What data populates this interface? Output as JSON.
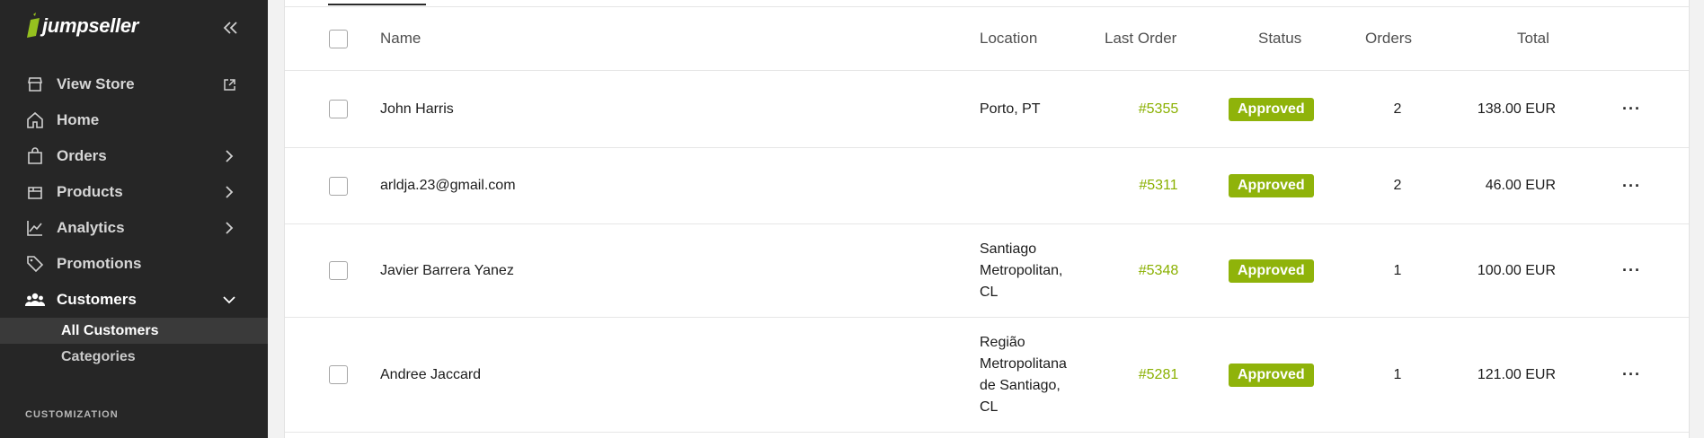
{
  "brand": {
    "name": "jumpseller"
  },
  "sidebar": {
    "items": [
      {
        "label": "View Store",
        "icon": "store-icon",
        "trail": "external-link-icon"
      },
      {
        "label": "Home",
        "icon": "home-icon"
      },
      {
        "label": "Orders",
        "icon": "bag-icon",
        "trail": "chevron-right-icon"
      },
      {
        "label": "Products",
        "icon": "box-icon",
        "trail": "chevron-right-icon"
      },
      {
        "label": "Analytics",
        "icon": "chart-icon",
        "trail": "chevron-right-icon"
      },
      {
        "label": "Promotions",
        "icon": "tag-icon"
      },
      {
        "label": "Customers",
        "icon": "users-icon",
        "trail": "chevron-down-icon"
      }
    ],
    "sub_items": [
      {
        "label": "All Customers"
      },
      {
        "label": "Categories"
      }
    ],
    "section": "CUSTOMIZATION"
  },
  "table": {
    "headers": {
      "name": "Name",
      "location": "Location",
      "last_order": "Last Order",
      "status": "Status",
      "orders": "Orders",
      "total": "Total"
    },
    "rows": [
      {
        "name": "John Harris",
        "location_lines": [
          "Porto, PT"
        ],
        "last_order": "#5355",
        "status": "Approved",
        "orders": "2",
        "total": "138.00 EUR"
      },
      {
        "name": "arldja.23@gmail.com",
        "location_lines": [],
        "last_order": "#5311",
        "status": "Approved",
        "orders": "2",
        "total": "46.00 EUR"
      },
      {
        "name": "Javier Barrera Yanez",
        "location_lines": [
          "Santiago",
          "Metropolitan,",
          "CL"
        ],
        "last_order": "#5348",
        "status": "Approved",
        "orders": "1",
        "total": "100.00 EUR"
      },
      {
        "name": "Andree Jaccard",
        "location_lines": [
          "Região",
          "Metropolitana",
          "de Santiago,",
          "CL"
        ],
        "last_order": "#5281",
        "status": "Approved",
        "orders": "1",
        "total": "121.00 EUR"
      }
    ],
    "more_actions_label": "···"
  },
  "colors": {
    "sidebar_bg": "#262626",
    "accent_green": "#8fb30a",
    "link_green": "#8ab000"
  }
}
